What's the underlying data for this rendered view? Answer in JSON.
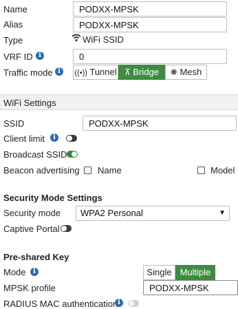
{
  "top": {
    "name_label": "Name",
    "name_value": "PODXX-MPSK",
    "alias_label": "Alias",
    "alias_value": "PODXX-MPSK",
    "type_label": "Type",
    "type_value": "WiFi SSID",
    "vrf_label": "VRF ID",
    "vrf_value": "0",
    "traffic_label": "Traffic mode",
    "traffic_options": [
      "Tunnel",
      "Bridge",
      "Mesh"
    ],
    "traffic_selected": "Bridge"
  },
  "wifi": {
    "section_title": "WiFi Settings",
    "ssid_label": "SSID",
    "ssid_value": "PODXX-MPSK",
    "client_limit_label": "Client limit",
    "broadcast_label": "Broadcast SSID",
    "beacon_label": "Beacon advertising",
    "beacon_options": [
      "Name",
      "Model"
    ]
  },
  "security": {
    "section_title": "Security Mode Settings",
    "mode_label": "Security mode",
    "mode_value": "WPA2 Personal",
    "captive_label": "Captive Portal"
  },
  "psk": {
    "section_title": "Pre-shared Key",
    "mode_label": "Mode",
    "mode_options": [
      "Single",
      "Multiple"
    ],
    "mode_selected": "Multiple",
    "profile_label": "MPSK profile",
    "profile_value": "PODXX-MPSK",
    "radius_label": "RADIUS MAC authentication"
  },
  "colors": {
    "accent_green": "#3d8c40",
    "info_blue": "#2b6cb0",
    "section_bg": "#f1f1f1"
  }
}
